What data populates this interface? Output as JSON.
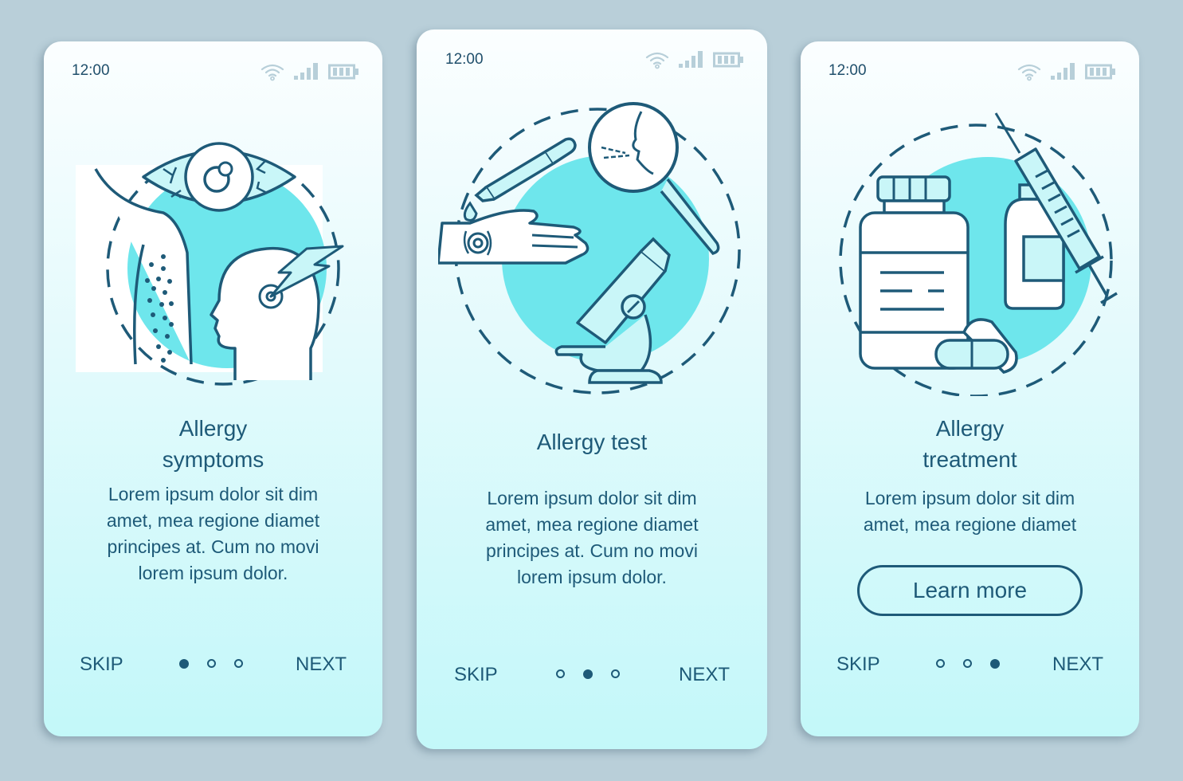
{
  "colors": {
    "background": "#b9cfd9",
    "primary_text": "#1e5a78",
    "accent_circle": "#6ee6ec",
    "status_icon": "#b7cfd9"
  },
  "screens": [
    {
      "status": {
        "time": "12:00",
        "icons": [
          "wifi-icon",
          "signal-icon",
          "battery-icon"
        ]
      },
      "illustration": "allergy-symptoms-illustration",
      "title_lines": [
        "Allergy",
        "symptoms"
      ],
      "body_lines": [
        "Lorem ipsum dolor sit dim",
        "amet, mea regione diamet",
        "principes at. Cum no movi",
        "lorem ipsum dolor."
      ],
      "nav": {
        "skip": "SKIP",
        "next": "NEXT",
        "page_count": 3,
        "active_page": 1
      }
    },
    {
      "status": {
        "time": "12:00",
        "icons": [
          "wifi-icon",
          "signal-icon",
          "battery-icon"
        ]
      },
      "illustration": "allergy-test-illustration",
      "title_lines": [
        "Allergy test"
      ],
      "body_lines": [
        "Lorem ipsum dolor sit dim",
        "amet, mea regione diamet",
        "principes at. Cum no movi",
        "lorem ipsum dolor."
      ],
      "nav": {
        "skip": "SKIP",
        "next": "NEXT",
        "page_count": 3,
        "active_page": 2
      }
    },
    {
      "status": {
        "time": "12:00",
        "icons": [
          "wifi-icon",
          "signal-icon",
          "battery-icon"
        ]
      },
      "illustration": "allergy-treatment-illustration",
      "title_lines": [
        "Allergy",
        "treatment"
      ],
      "body_lines": [
        "Lorem ipsum dolor sit dim",
        "amet, mea regione diamet"
      ],
      "button": "Learn more",
      "nav": {
        "skip": "SKIP",
        "next": "NEXT",
        "page_count": 3,
        "active_page": 3
      }
    }
  ]
}
